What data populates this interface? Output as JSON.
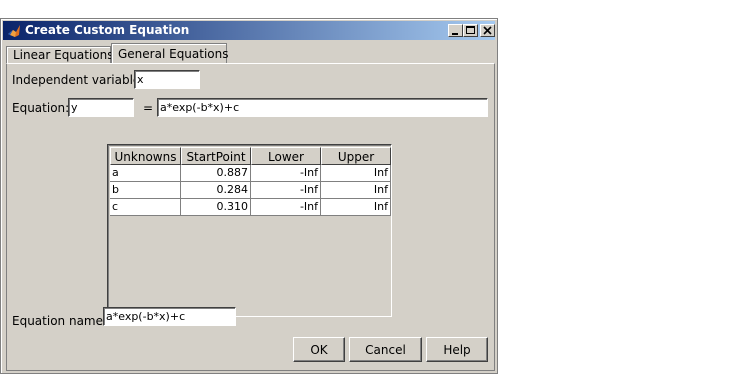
{
  "window": {
    "title": "Create Custom Equation"
  },
  "tabs": [
    {
      "label": "Linear Equations",
      "active": false
    },
    {
      "label": "General Equations",
      "active": true
    }
  ],
  "form": {
    "independent_variable_label": "Independent variable:",
    "independent_variable_value": "x",
    "equation_label": "Equation:",
    "equation_lhs_value": "y",
    "equals_sign": "=",
    "equation_rhs_value": "a*exp(-b*x)+c",
    "equation_name_label": "Equation name:",
    "equation_name_value": "a*exp(-b*x)+c"
  },
  "table": {
    "columns": [
      "Unknowns",
      "StartPoint",
      "Lower",
      "Upper"
    ],
    "rows": [
      [
        "a",
        "0.887",
        "-Inf",
        "Inf"
      ],
      [
        "b",
        "0.284",
        "-Inf",
        "Inf"
      ],
      [
        "c",
        "0.310",
        "-Inf",
        "Inf"
      ]
    ]
  },
  "buttons": {
    "ok": "OK",
    "cancel": "Cancel",
    "help": "Help"
  }
}
